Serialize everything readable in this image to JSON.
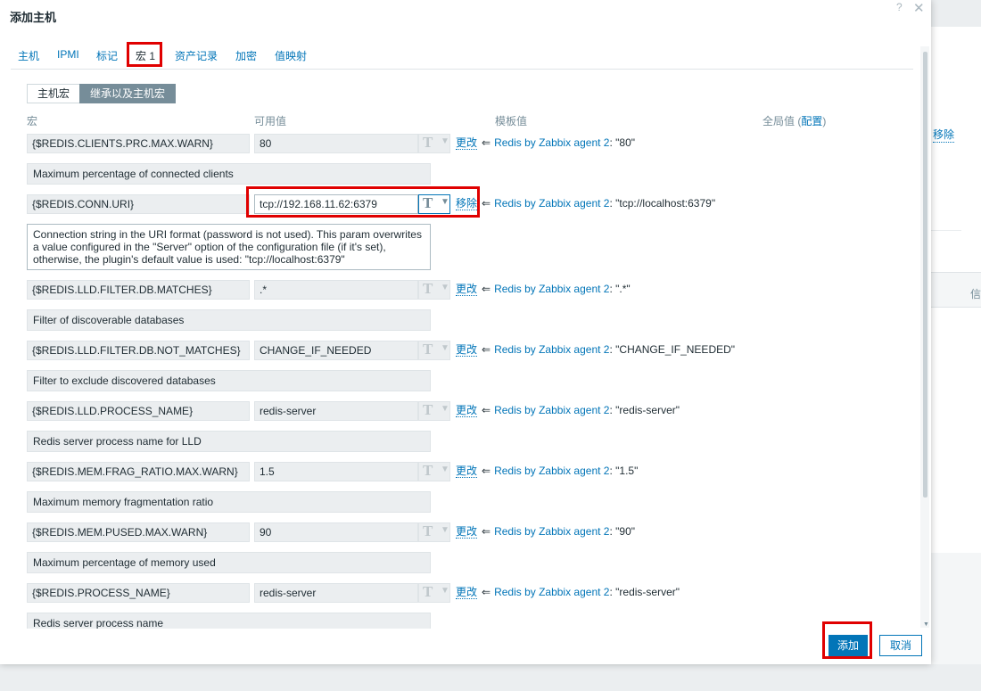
{
  "background": {
    "link": "移除",
    "column_header": "信"
  },
  "dialog": {
    "title": "添加主机",
    "help": "?",
    "close": "✕",
    "tabs": [
      {
        "label": "主机"
      },
      {
        "label": "IPMI"
      },
      {
        "label": "标记"
      },
      {
        "label": "宏 1"
      },
      {
        "label": "资产记录"
      },
      {
        "label": "加密"
      },
      {
        "label": "值映射"
      }
    ],
    "active_tab": "宏 1",
    "toggle": {
      "host_macros": "主机宏",
      "inherited_macros": "继承以及主机宏",
      "selected": "继承以及主机宏"
    },
    "columns": {
      "macro": "宏",
      "effective_value": "可用值",
      "template_value": "模板值",
      "global_value": "全局值 (",
      "config_link": "配置",
      "global_value_end": ")"
    },
    "arrow_glyph": "⇐",
    "type_icon": "T",
    "macros": [
      {
        "macro": "{$REDIS.CLIENTS.PRC.MAX.WARN}",
        "value": "80",
        "action": "更改",
        "template": "Redis by Zabbix agent 2",
        "template_value": ": \"80\"",
        "description": "Maximum percentage of connected clients"
      },
      {
        "macro": "{$REDIS.CONN.URI}",
        "value": "tcp://192.168.11.62:6379",
        "action": "移除",
        "template": "Redis by Zabbix agent 2",
        "template_value": ": \"tcp://localhost:6379\"",
        "description": "Connection string in the URI format (password is not used). This param overwrites a value configured in the \"Server\" option of the configuration file (if it's set), otherwise, the plugin's default value is used: \"tcp://localhost:6379\""
      },
      {
        "macro": "{$REDIS.LLD.FILTER.DB.MATCHES}",
        "value": ".*",
        "action": "更改",
        "template": "Redis by Zabbix agent 2",
        "template_value": ": \".*\"",
        "description": "Filter of discoverable databases"
      },
      {
        "macro": "{$REDIS.LLD.FILTER.DB.NOT_MATCHES}",
        "value": "CHANGE_IF_NEEDED",
        "action": "更改",
        "template": "Redis by Zabbix agent 2",
        "template_value": ": \"CHANGE_IF_NEEDED\"",
        "description": "Filter to exclude discovered databases"
      },
      {
        "macro": "{$REDIS.LLD.PROCESS_NAME}",
        "value": "redis-server",
        "action": "更改",
        "template": "Redis by Zabbix agent 2",
        "template_value": ": \"redis-server\"",
        "description": "Redis server process name for LLD"
      },
      {
        "macro": "{$REDIS.MEM.FRAG_RATIO.MAX.WARN}",
        "value": "1.5",
        "action": "更改",
        "template": "Redis by Zabbix agent 2",
        "template_value": ": \"1.5\"",
        "description": "Maximum memory fragmentation ratio"
      },
      {
        "macro": "{$REDIS.MEM.PUSED.MAX.WARN}",
        "value": "90",
        "action": "更改",
        "template": "Redis by Zabbix agent 2",
        "template_value": ": \"90\"",
        "description": "Maximum percentage of memory used"
      },
      {
        "macro": "{$REDIS.PROCESS_NAME}",
        "value": "redis-server",
        "action": "更改",
        "template": "Redis by Zabbix agent 2",
        "template_value": ": \"redis-server\"",
        "description": "Redis server process name"
      }
    ],
    "buttons": {
      "add": "添加",
      "cancel": "取消"
    },
    "colors": {
      "link": "#0275b8",
      "highlight": "#e00000",
      "primary_button": "#0275b8"
    }
  }
}
